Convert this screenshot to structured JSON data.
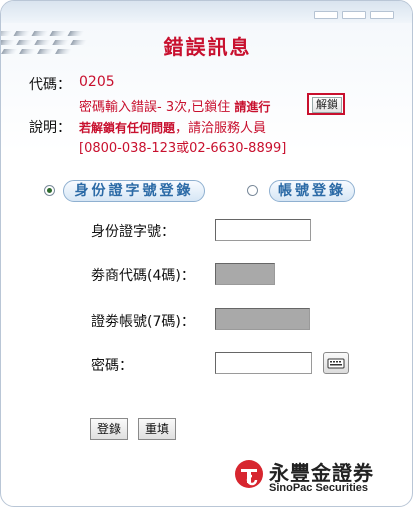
{
  "title": "錯誤訊息",
  "code": {
    "label": "代碼：",
    "value": "0205"
  },
  "description": {
    "label": "說明：",
    "line1_prefix": "密碼輸入錯誤- 3次,已鎖住 ",
    "line1_bold": "請進行",
    "line2_bold": "若解鎖有任何問題",
    "line2_rest": "，請洽服務人員",
    "line3": "[0800-038-123或02-6630-8899]"
  },
  "unlock_button": "解鎖",
  "login_modes": {
    "id_login": {
      "label": "身份證字號登錄",
      "selected": true
    },
    "account_login": {
      "label": "帳號登錄",
      "selected": false
    }
  },
  "fields": {
    "id_number": {
      "label": "身份證字號：",
      "value": ""
    },
    "broker_code": {
      "label": "劵商代碼(4碼)：",
      "value": ""
    },
    "account_no": {
      "label": "證劵帳號(7碼)：",
      "value": ""
    },
    "password": {
      "label": "密碼：",
      "value": ""
    }
  },
  "buttons": {
    "login": "登錄",
    "reset": "重填"
  },
  "brand": {
    "name_cn": "永豐金證券",
    "name_en": "SinoPac Securities"
  },
  "colors": {
    "accent_red": "#c8102e",
    "pill_text": "#2b6aa6",
    "logo_red": "#d7262f"
  },
  "icons": {
    "keyboard_button": "keyboard-icon",
    "logo": "sinopac-logo-icon"
  }
}
